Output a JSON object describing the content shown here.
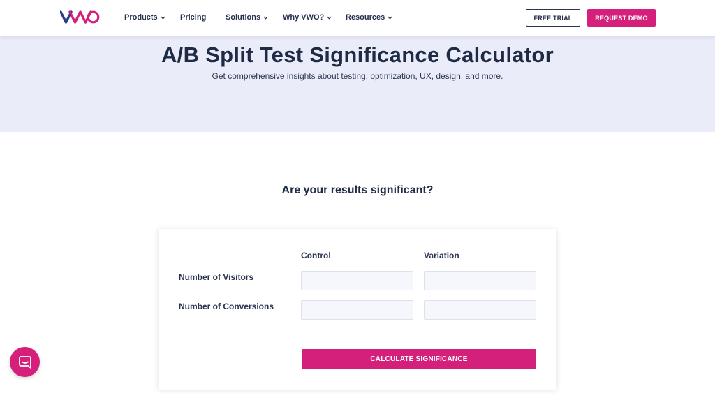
{
  "header": {
    "logo_text": "VWO",
    "nav": [
      {
        "label": "Products",
        "has_dropdown": true
      },
      {
        "label": "Pricing",
        "has_dropdown": false
      },
      {
        "label": "Solutions",
        "has_dropdown": true
      },
      {
        "label": "Why VWO?",
        "has_dropdown": true
      },
      {
        "label": "Resources",
        "has_dropdown": true
      }
    ],
    "free_trial_label": "FREE TRIAL",
    "request_demo_label": "REQUEST DEMO"
  },
  "hero": {
    "title": "A/B Split Test Significance Calculator",
    "subtitle": "Get comprehensive insights about testing, optimization, UX, design, and more."
  },
  "calculator": {
    "question": "Are your results significant?",
    "columns": [
      "Control",
      "Variation"
    ],
    "rows": [
      {
        "label": "Number of Visitors",
        "control_value": "",
        "variation_value": ""
      },
      {
        "label": "Number of Conversions",
        "control_value": "",
        "variation_value": ""
      }
    ],
    "submit_label": "CALCULATE SIGNIFICANCE"
  },
  "chat": {
    "icon": "chat-bubble-icon"
  },
  "colors": {
    "brand_pink": "#d4207a",
    "navy_text": "#1f2a44",
    "hero_bg": "#eaecf9"
  }
}
